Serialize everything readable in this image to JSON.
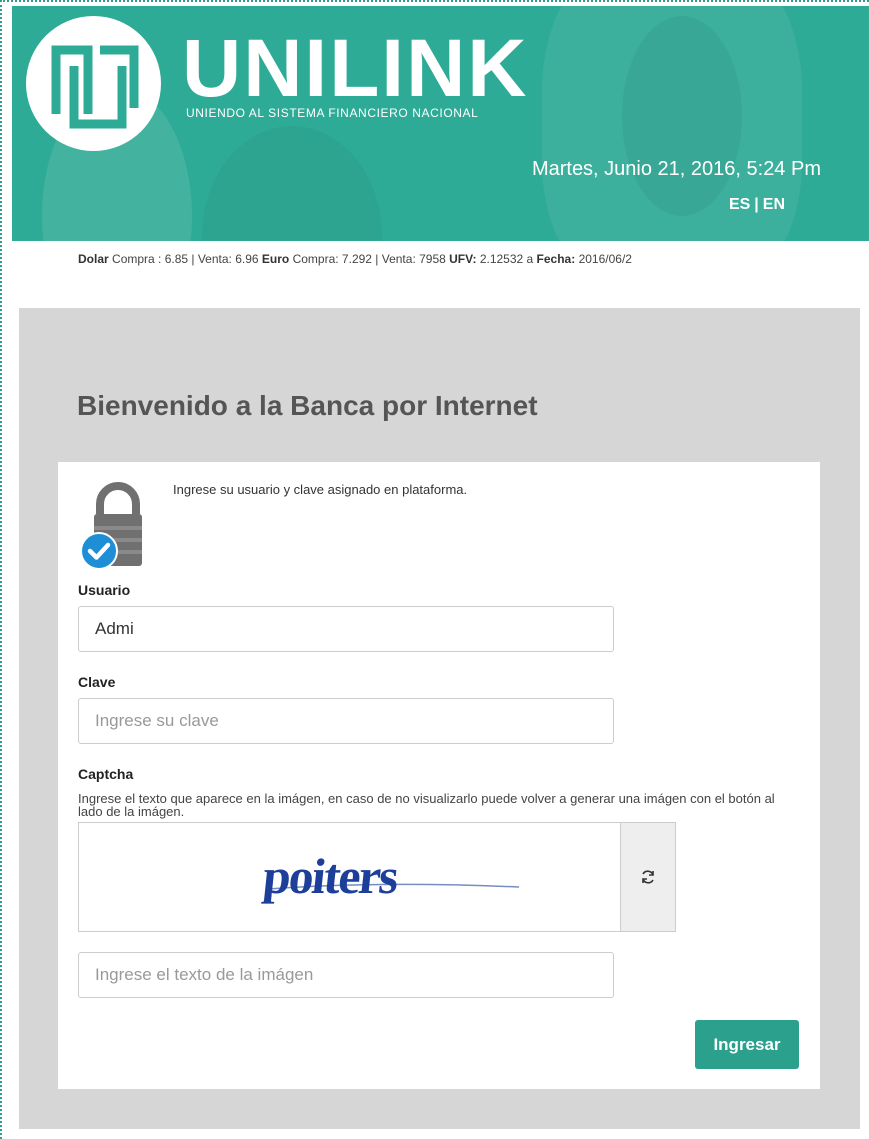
{
  "header": {
    "brand": "UNILINK",
    "tagline": "UNIENDO AL SISTEMA FINANCIERO NACIONAL",
    "datetime": "Martes, Junio 21, 2016, 5:24 Pm",
    "languages": [
      "ES",
      "EN"
    ],
    "language_separator": "|"
  },
  "ticker": {
    "dolar_label": "Dolar",
    "dolar_text": " Compra : 6.85 | Venta: 6.96 ",
    "euro_label": "Euro",
    "euro_text": " Compra: 7.292 | Venta: 7958 ",
    "ufv_label": "UFV:",
    "ufv_text": " 2.12532 a ",
    "fecha_label": "Fecha:",
    "fecha_text": " 2016/06/2"
  },
  "panel": {
    "title": "Bienvenido a la Banca por Internet"
  },
  "login": {
    "intro": "Ingrese su usuario y clave asignado en plataforma.",
    "usuario_label": "Usuario",
    "usuario_value": "Admi",
    "clave_label": "Clave",
    "clave_placeholder": "Ingrese su clave",
    "captcha_label": "Captcha",
    "captcha_help": "Ingrese el texto que aparece en la imágen, en caso de no visualizarlo puede volver a generar una imágen con el botón al lado de la imágen.",
    "captcha_text": "poiters",
    "captcha_input_placeholder": "Ingrese el texto de la imágen",
    "submit_label": "Ingresar"
  },
  "colors": {
    "brand_teal": "#2eab96",
    "button_teal": "#2aa08d",
    "panel_gray": "#d6d6d6",
    "captcha_blue": "#1d3f9a",
    "check_blue": "#1e8fd6"
  },
  "icons": {
    "logo": "unilink-logo-icon",
    "lock": "lock-icon",
    "check": "checkmark-icon",
    "refresh": "refresh-icon"
  }
}
